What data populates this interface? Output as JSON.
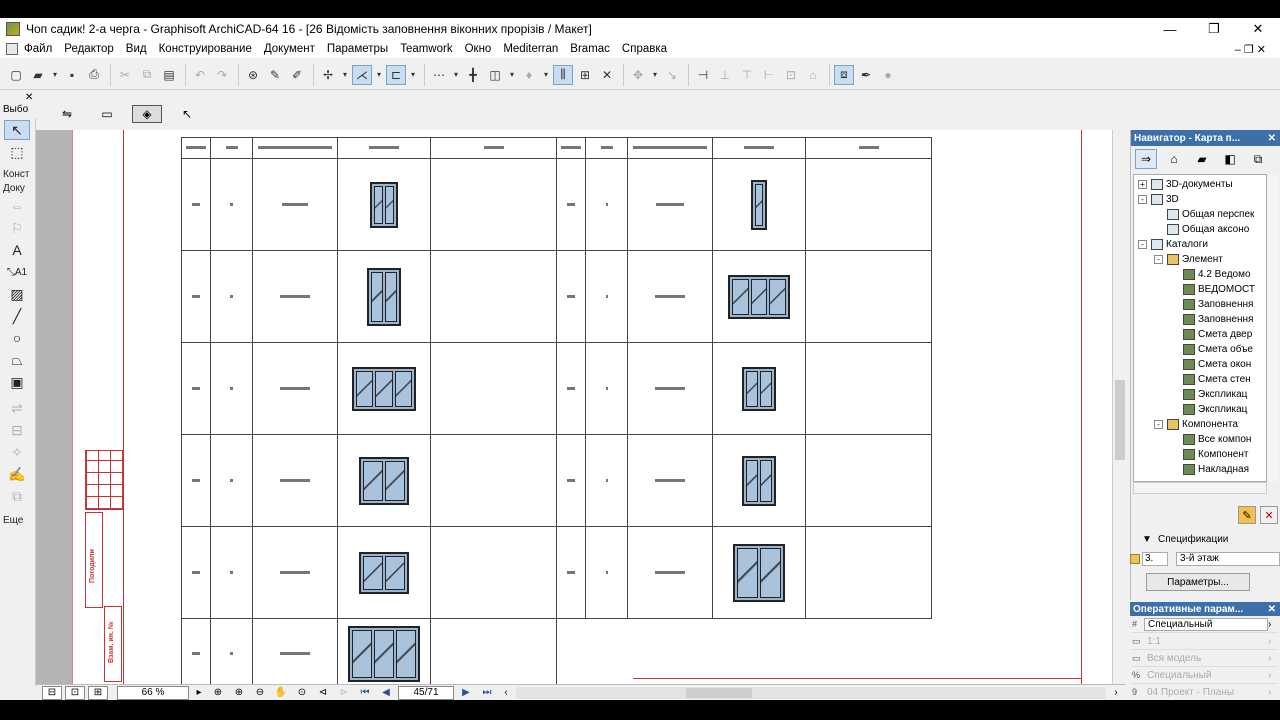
{
  "window": {
    "title": "Чоп садик! 2-а черга - Graphisoft ArchiCAD-64 16 - [26 Відомість заповнення віконних прорізів / Макет]",
    "controls": {
      "minimize": "—",
      "restore": "❐",
      "close": "✕"
    }
  },
  "menu": {
    "items": [
      "Файл",
      "Редактор",
      "Вид",
      "Конструирование",
      "Документ",
      "Параметры",
      "Teamwork",
      "Окно",
      "Mediterran",
      "Bramac",
      "Справка"
    ],
    "mdi_controls": "–  ❐  ✕"
  },
  "toolbox": {
    "title": "Выбо",
    "close": "✕",
    "labels": {
      "konst": "Конст",
      "doku": "Доку",
      "more": "Еще"
    },
    "tools": [
      "arrow-pointer",
      "marquee",
      "line-level",
      "elevation",
      "text",
      "label",
      "fill",
      "line",
      "circle",
      "polyline",
      "figure",
      "section",
      "dim",
      "change",
      "drawing"
    ]
  },
  "navigator": {
    "title": "Навигатор - Карта п...",
    "close": "✕",
    "tree": [
      {
        "label": "3D-документы",
        "level": 0,
        "expander": "+"
      },
      {
        "label": "3D",
        "level": 0,
        "expander": "-"
      },
      {
        "label": "Общая перспек",
        "level": 1
      },
      {
        "label": "Общая аксоно",
        "level": 1
      },
      {
        "label": "Каталоги",
        "level": 0,
        "expander": "-"
      },
      {
        "label": "Элемент",
        "level": 1,
        "expander": "-"
      },
      {
        "label": "4.2 Ведомо",
        "level": 2
      },
      {
        "label": "ВЕДОМОСТ",
        "level": 2
      },
      {
        "label": "Заповнення",
        "level": 2
      },
      {
        "label": "Заповнення",
        "level": 2
      },
      {
        "label": "Смета двер",
        "level": 2
      },
      {
        "label": "Смета объе",
        "level": 2
      },
      {
        "label": "Смета окон",
        "level": 2
      },
      {
        "label": "Смета стен",
        "level": 2
      },
      {
        "label": "Экспликац",
        "level": 2
      },
      {
        "label": "Экспликац",
        "level": 2
      },
      {
        "label": "Компонента",
        "level": 1,
        "expander": "-"
      },
      {
        "label": "Все компон",
        "level": 2
      },
      {
        "label": "Компонент",
        "level": 2
      },
      {
        "label": "Накладная",
        "level": 2
      }
    ]
  },
  "spec": {
    "heading": "Спецификации",
    "id_value": "3.",
    "name_value": "3-й этаж",
    "params_button": "Параметры..."
  },
  "props": {
    "title": "Оперативные парам...",
    "close": "✕",
    "rows": [
      {
        "icon": "#",
        "value": "Специальный",
        "arrow": "›",
        "dim": false
      },
      {
        "icon": "▭",
        "value": "1:1",
        "arrow": "›",
        "dim": true
      },
      {
        "icon": "▭",
        "value": "Вся модель",
        "arrow": "›",
        "dim": true
      },
      {
        "icon": "%",
        "value": "Специальный",
        "arrow": "›",
        "dim": true
      },
      {
        "icon": "9",
        "value": "04 Проект - Планы",
        "arrow": "›",
        "dim": true
      }
    ]
  },
  "status": {
    "zoom": "66 %",
    "page": "45/71"
  },
  "stamp_texts": [
    "Погодили",
    "Взам. ин. №"
  ]
}
